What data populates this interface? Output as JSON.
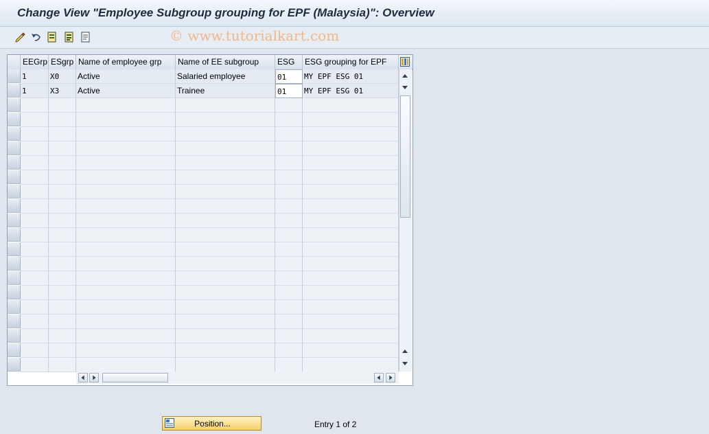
{
  "window": {
    "title": "Change View \"Employee Subgroup grouping for EPF (Malaysia)\": Overview"
  },
  "toolbar": {
    "icons": [
      "edit-pencil-icon",
      "undo-icon",
      "save-variant-icon",
      "list-icon",
      "document-icon"
    ]
  },
  "watermark": "© www.tutorialkart.com",
  "table": {
    "columns": [
      "EEGrp",
      "ESgrp",
      "Name of employee grp",
      "Name of EE subgroup",
      "ESG",
      "ESG grouping for EPF"
    ],
    "rows": [
      [
        "1",
        "X0",
        "Active",
        "Salaried employee",
        "01",
        "MY EPF ESG 01"
      ],
      [
        "1",
        "X3",
        "Active",
        "Trainee",
        "01",
        "MY EPF ESG 01"
      ]
    ]
  },
  "footer": {
    "position_button": "Position...",
    "entry_text": "Entry 1 of 2"
  },
  "colors": {
    "button_bg": "#f5cf6a",
    "watermark": "#f0b787",
    "title": "#1e2c3e"
  }
}
